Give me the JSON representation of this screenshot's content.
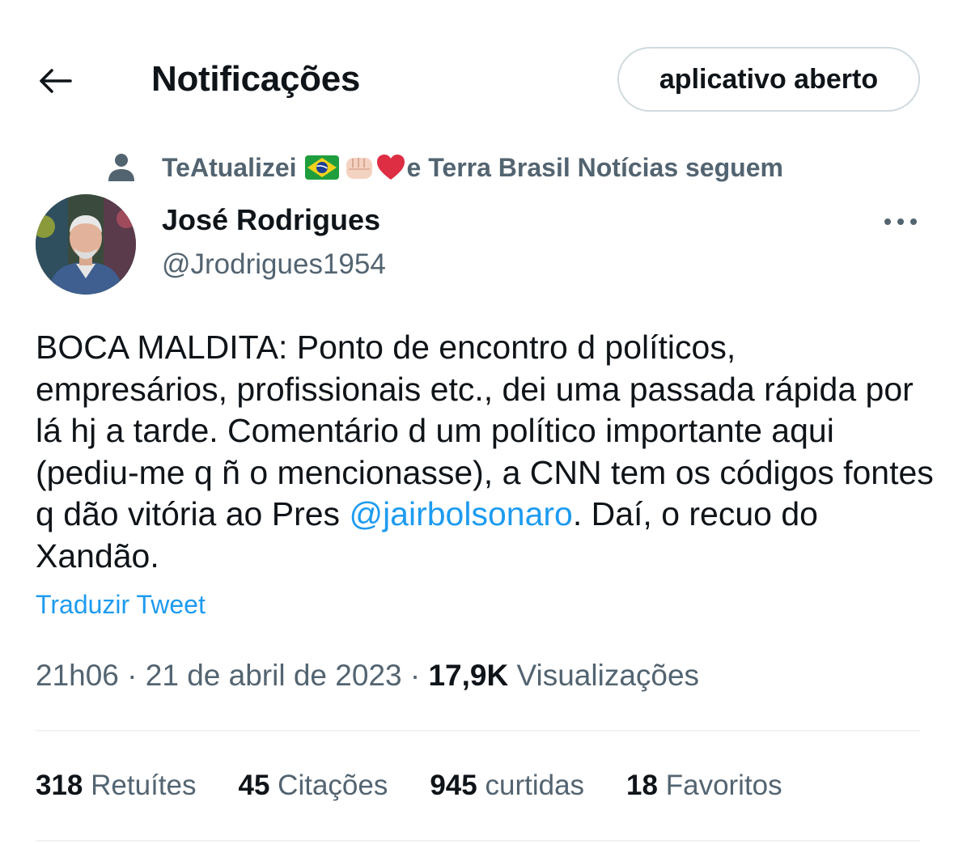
{
  "header": {
    "back_icon": "arrow-left-icon",
    "title": "Notificações",
    "open_app_label": "aplicativo aberto"
  },
  "social_context": {
    "icon": "person-icon",
    "name_part": "TeAtualizei",
    "emojis": [
      "brazil-flag",
      "fist",
      "red-heart"
    ],
    "suffix": "e Terra Brasil Notícias seguem"
  },
  "author": {
    "name": "José Rodrigues",
    "handle": "@Jrodrigues1954"
  },
  "tweet": {
    "text_part1": "BOCA MALDITA: Ponto de encontro d políticos, empresários, profissionais etc., dei uma passada rápida por lá hj a tarde. Comentário d um político importante aqui (pediu-me q ñ o mencionasse), a CNN tem os códigos fontes q dão vitória ao Pres ",
    "mention": "@jairbolsonaro",
    "text_part2": ". Daí, o recuo do Xandão.",
    "translate_label": "Traduzir Tweet"
  },
  "meta": {
    "time": "21h06",
    "separator": "·",
    "date": "21 de abril de 2023",
    "views_count": "17,9K",
    "views_label": "Visualizações"
  },
  "stats": [
    {
      "count": "318",
      "label": "Retuítes"
    },
    {
      "count": "45",
      "label": "Citações"
    },
    {
      "count": "945",
      "label": "curtidas"
    },
    {
      "count": "18",
      "label": "Favoritos"
    }
  ],
  "colors": {
    "text": "#0f1419",
    "secondary": "#536471",
    "link": "#1d9bf0",
    "border": "#cfd9de",
    "divider": "#eff3f4"
  }
}
